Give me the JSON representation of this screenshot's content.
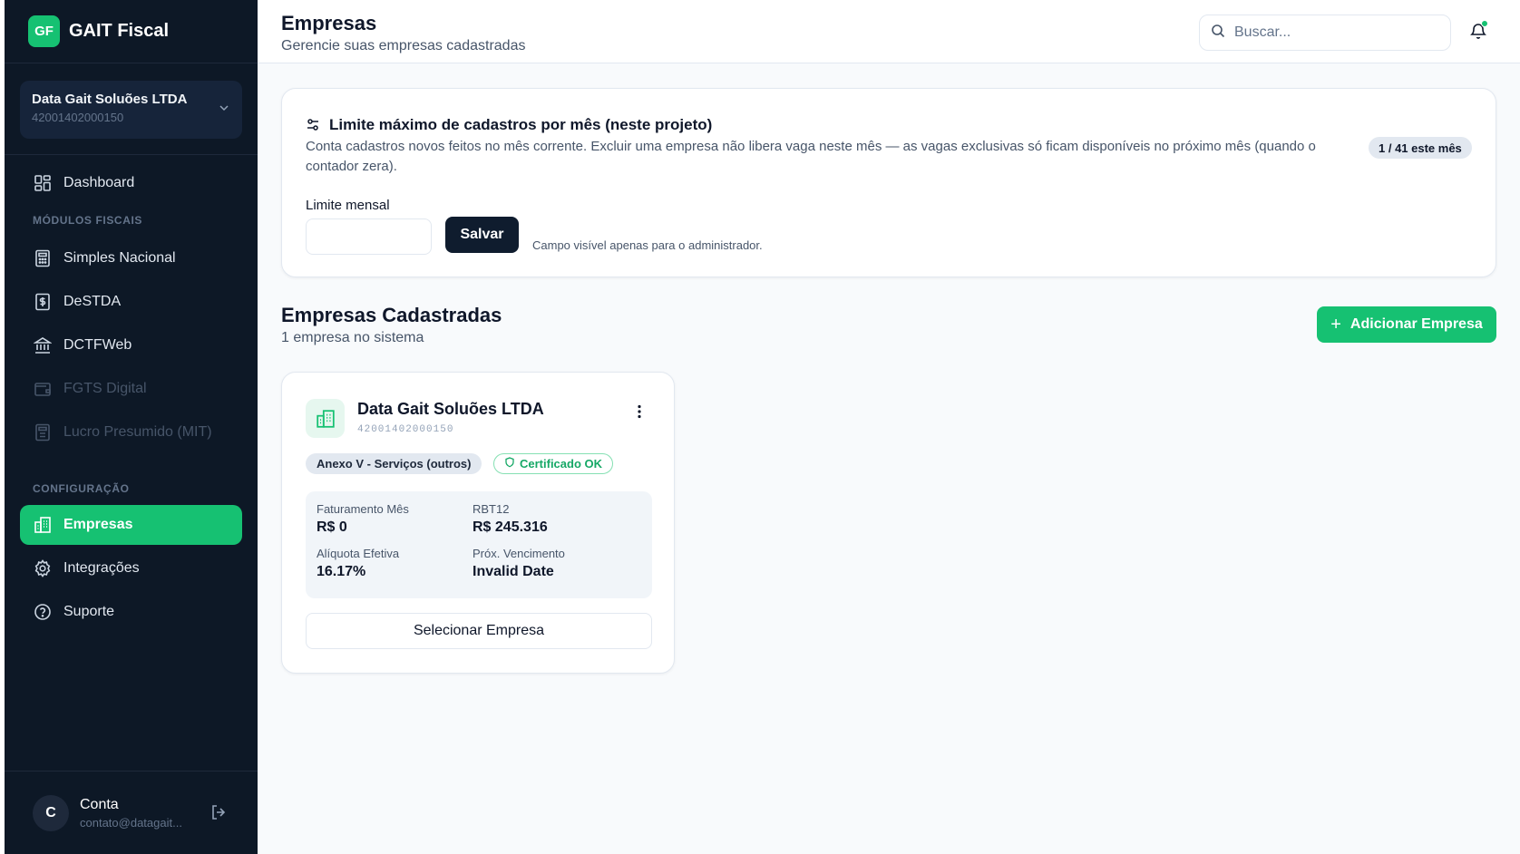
{
  "brand": {
    "logo_text": "GF",
    "name": "GAIT Fiscal"
  },
  "company_selector": {
    "name": "Data Gait Soluões LTDA",
    "cnpj": "42001402000150"
  },
  "nav": {
    "dashboard": "Dashboard",
    "section_fiscal": "MÓDULOS FISCAIS",
    "simples": "Simples Nacional",
    "destda": "DeSTDA",
    "dctfweb": "DCTFWeb",
    "fgts": "FGTS Digital",
    "lucro": "Lucro Presumido (MIT)",
    "section_config": "CONFIGURAÇÃO",
    "empresas": "Empresas",
    "integracoes": "Integrações",
    "suporte": "Suporte"
  },
  "account": {
    "avatar": "C",
    "name": "Conta",
    "email": "contato@datagait..."
  },
  "header": {
    "title": "Empresas",
    "subtitle": "Gerencie suas empresas cadastradas",
    "search_placeholder": "Buscar..."
  },
  "limit_card": {
    "title": "Limite máximo de cadastros por mês (neste projeto)",
    "description": "Conta cadastros novos feitos no mês corrente. Excluir uma empresa não libera vaga neste mês — as vagas exclusivas só ficam disponíveis no próximo mês (quando o contador zera).",
    "badge": "1 / 41 este mês",
    "input_label": "Limite mensal",
    "input_value": "",
    "save_label": "Salvar",
    "hint": "Campo visível apenas para o administrador."
  },
  "companies_section": {
    "title": "Empresas Cadastradas",
    "subtitle": "1 empresa no sistema",
    "add_label": "Adicionar Empresa"
  },
  "company_card": {
    "name": "Data Gait Soluões LTDA",
    "cnpj": "42001402000150",
    "tag": "Anexo V - Serviços (outros)",
    "cert": "Certificado OK",
    "stats": {
      "faturamento_label": "Faturamento Mês",
      "faturamento_value": "R$ 0",
      "rbt12_label": "RBT12",
      "rbt12_value": "R$ 245.316",
      "aliquota_label": "Alíquota Efetiva",
      "aliquota_value": "16.17%",
      "vencimento_label": "Próx. Vencimento",
      "vencimento_value": "Invalid Date"
    },
    "select_label": "Selecionar Empresa"
  },
  "colors": {
    "sidebar_bg": "#0d1826",
    "accent": "#16c172",
    "primary_dark": "#0f1c2e"
  }
}
